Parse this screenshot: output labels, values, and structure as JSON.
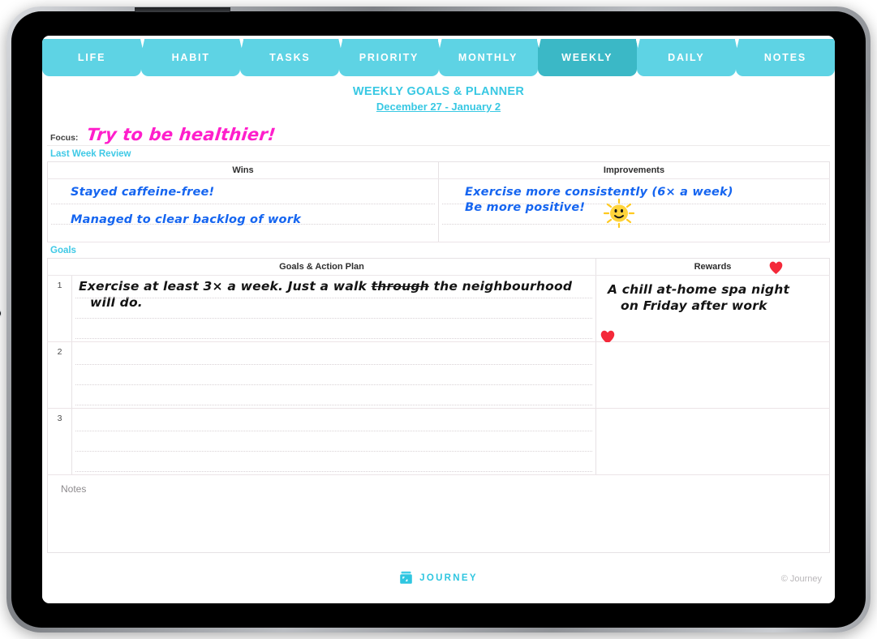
{
  "tabs": [
    {
      "label": "LIFE",
      "active": false
    },
    {
      "label": "HABIT",
      "active": false
    },
    {
      "label": "TASKS",
      "active": false
    },
    {
      "label": "PRIORITY",
      "active": false
    },
    {
      "label": "MONTHLY",
      "active": false
    },
    {
      "label": "WEEKLY",
      "active": true
    },
    {
      "label": "DAILY",
      "active": false
    },
    {
      "label": "NOTES",
      "active": false
    }
  ],
  "document": {
    "title": "WEEKLY GOALS & PLANNER",
    "date_range": "December 27 - January 2"
  },
  "focus": {
    "label": "Focus:",
    "value": "Try to be healthier!",
    "color": "#ff1ecb"
  },
  "last_week_review": {
    "section_label": "Last Week Review",
    "columns": [
      "Wins",
      "Improvements"
    ],
    "wins": [
      "Stayed  caffeine-free!",
      "Managed to clear backlog of work"
    ],
    "improvements": [
      "Exercise more consistently  (6× a week)",
      "Be more positive!"
    ],
    "sticker": "sun-smiley-sticker"
  },
  "goals": {
    "section_label": "Goals",
    "columns": [
      "Goals & Action Plan",
      "Rewards"
    ],
    "rows": [
      {
        "number": "1",
        "plan_line1_a": "Exercise at least 3× a week. Just a walk ",
        "plan_line1_strike": "through",
        "plan_line1_b": " the neighbourhood",
        "plan_line2": "will do.",
        "reward_line1": "A chill at-home spa night",
        "reward_line2": "on Friday after work"
      },
      {
        "number": "2",
        "plan_line1_a": "",
        "plan_line1_strike": "",
        "plan_line1_b": "",
        "plan_line2": "",
        "reward_line1": "",
        "reward_line2": ""
      },
      {
        "number": "3",
        "plan_line1_a": "",
        "plan_line1_strike": "",
        "plan_line1_b": "",
        "plan_line2": "",
        "reward_line1": "",
        "reward_line2": ""
      }
    ],
    "stickers": [
      "heart-sticker",
      "heart-sticker"
    ]
  },
  "notes": {
    "label": "Notes",
    "value": ""
  },
  "footer": {
    "brand": "JOURNEY",
    "copyright": "© Journey",
    "logo": "journey-jar-logo"
  },
  "theme": {
    "tab_color": "#5ed3e4",
    "tab_active_color": "#3bb8c6",
    "heading_color": "#38c8e3",
    "handwriting_blue": "#1565f0",
    "handwriting_pink": "#ff1ecb",
    "heart_red": "#f4293a",
    "sun_yellow": "#ffd43b"
  }
}
